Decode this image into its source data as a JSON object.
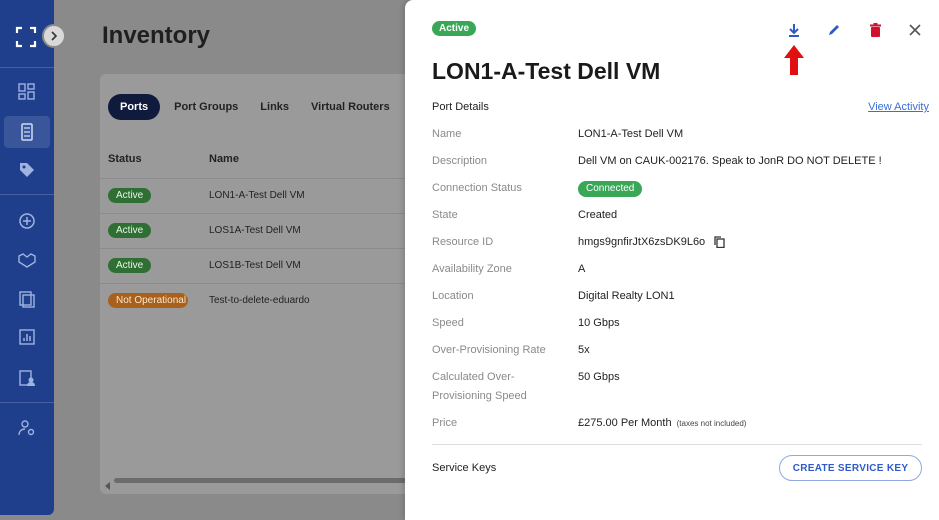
{
  "page": {
    "title": "Inventory"
  },
  "tabs": [
    {
      "label": "Ports"
    },
    {
      "label": "Port Groups"
    },
    {
      "label": "Links"
    },
    {
      "label": "Virtual Routers"
    }
  ],
  "table": {
    "headers": [
      "Status",
      "Name"
    ],
    "rows": [
      {
        "status": "Active",
        "name": "LON1-A-Test Dell VM"
      },
      {
        "status": "Active",
        "name": "LOS1A-Test Dell VM"
      },
      {
        "status": "Active",
        "name": "LOS1B-Test Dell VM"
      },
      {
        "status": "Not Operational",
        "name": "Test-to-delete-eduardo"
      }
    ]
  },
  "drawer": {
    "status_badge": "Active",
    "title": "LON1-A-Test Dell VM",
    "section_label": "Port Details",
    "view_activity": "View Activity",
    "fields": [
      {
        "label": "Name",
        "value": "LON1-A-Test Dell VM"
      },
      {
        "label": "Description",
        "value": "Dell VM on CAUK-002176. Speak to JonR DO NOT DELETE !"
      },
      {
        "label": "Connection Status",
        "value": "Connected"
      },
      {
        "label": "State",
        "value": "Created"
      },
      {
        "label": "Resource ID",
        "value": "hmgs9gnfirJtX6zsDK9L6o"
      },
      {
        "label": "Availability Zone",
        "value": "A"
      },
      {
        "label": "Location",
        "value": "Digital Realty LON1"
      },
      {
        "label": "Speed",
        "value": "10 Gbps"
      },
      {
        "label": "Over-Provisioning Rate",
        "value": "5x"
      },
      {
        "label": "Calculated Over-Provisioning Speed",
        "value": "50 Gbps"
      },
      {
        "label": "Price",
        "value": "£275.00 Per Month",
        "note": "(taxes not included)"
      }
    ],
    "service_keys_label": "Service Keys",
    "create_service_key": "CREATE SERVICE KEY",
    "actions": [
      "download-icon",
      "edit-icon",
      "delete-icon",
      "close-icon"
    ]
  },
  "colors": {
    "sidebar": "#1f3f8c",
    "active_green": "#3aa757",
    "delete_red": "#d0122d",
    "link_blue": "#3a6fd8",
    "arrow_red": "#e01010"
  }
}
